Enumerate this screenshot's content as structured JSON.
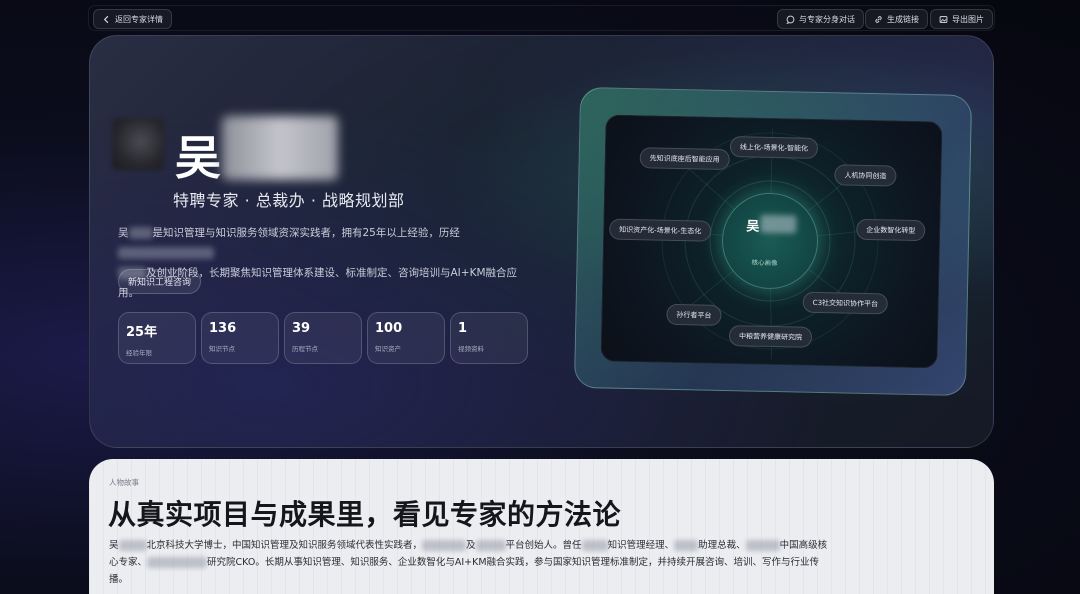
{
  "toolbar": {
    "back_label": "返回专家详情",
    "chat_label": "与专家分身对话",
    "link_label": "生成链接",
    "export_label": "导出图片"
  },
  "hero": {
    "surname": "吴",
    "title": "特聘专家 · 总裁办 · 战略规划部",
    "desc_part1": "吴",
    "desc_part2": "是知识管理与知识服务领域资深实践者，拥有25年以上经验，历经",
    "desc_part3": "及创业阶段，长期聚焦知识管理体系建设、标准制定、咨询培训与AI+KM融合应用。",
    "tag": "新知识工程咨询",
    "stats": [
      {
        "value": "25年",
        "label": "经验年限"
      },
      {
        "value": "136",
        "label": "知识节点"
      },
      {
        "value": "39",
        "label": "历程节点"
      },
      {
        "value": "100",
        "label": "知识资产"
      },
      {
        "value": "1",
        "label": "视频资料"
      }
    ]
  },
  "portrait": {
    "core_surname": "吴",
    "core_label": "核心画像",
    "nodes": [
      "线上化-场景化-智能化",
      "先知识底座后智能应用",
      "人机协同创造",
      "知识资产化-场景化-生态化",
      "企业数智化转型",
      "C3社交知识协作平台",
      "孙行者平台",
      "中粮营养健康研究院"
    ]
  },
  "story": {
    "kicker": "人物故事",
    "heading": "从真实项目与成果里，看见专家的方法论",
    "p_1": "吴",
    "p_2": "北京科技大学博士，中国知识管理及知识服务领域代表性实践者，",
    "p_3": "及",
    "p_4": "平台创始人。曾任",
    "p_5": "知识管理经理、",
    "p_6": "助理总裁、",
    "p_7": "中国高级核心专家、",
    "p_8": "研究院CKO。长期从事知识管理、知识服务、企业数智化与AI+KM融合实践，参与国家知识管理标准制定，并持续开展咨询、培训、写作与行业传播。"
  }
}
